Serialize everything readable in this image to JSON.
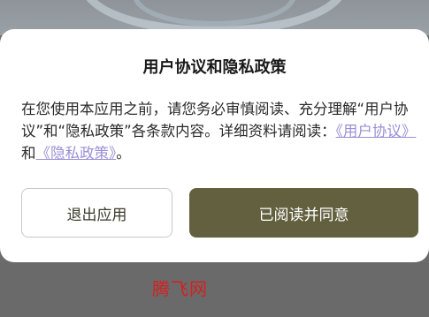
{
  "dialog": {
    "title": "用户协议和隐私政策",
    "body_prefix": "在您使用本应用之前，请您务必审慎阅读、充分理解“用户协议”和“隐私政策”各条款内容。详细资料请阅读：",
    "user_agreement_link": "《用户协议》",
    "conjunction": "和",
    "privacy_policy_link": "《隐私政策》",
    "body_suffix": "。",
    "exit_label": "退出应用",
    "agree_label": "已阅读并同意"
  },
  "watermark": "腾飞网",
  "colors": {
    "agree_button": "#63603f",
    "link": "#9a8fd6",
    "overlay": "#6b6b6b",
    "watermark": "#d42020"
  }
}
